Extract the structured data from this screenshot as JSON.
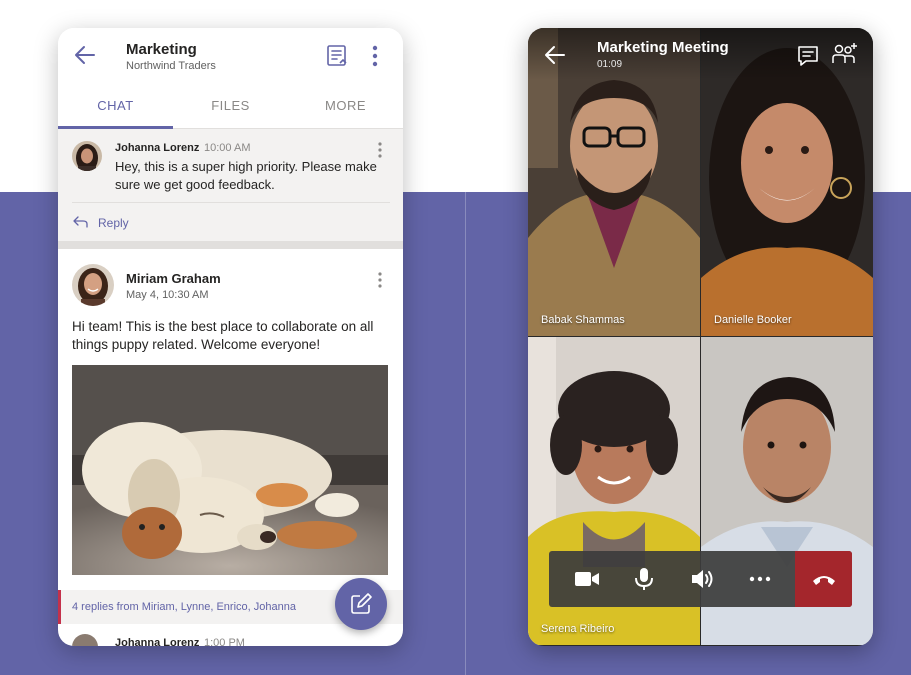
{
  "chat_screen": {
    "header": {
      "title": "Marketing",
      "subtitle": "Northwind Traders"
    },
    "tabs": [
      {
        "label": "CHAT",
        "active": true
      },
      {
        "label": "FILES",
        "active": false
      },
      {
        "label": "MORE",
        "active": false
      }
    ],
    "messages": [
      {
        "author": "Johanna Lorenz",
        "time": "10:00 AM",
        "text": "Hey, this is a super high priority. Please make sure we get good feedback.",
        "reply_label": "Reply"
      },
      {
        "author": "Miriam Graham",
        "time": "May 4, 10:30 AM",
        "text": "Hi team! This is the best place to collaborate on all things puppy related. Welcome everyone!",
        "replies_summary": "4 replies from Miriam, Lynne, Enrico, Johanna"
      },
      {
        "author": "Johanna Lorenz",
        "time": "1:00 PM"
      }
    ],
    "accent_color": "#6264a7"
  },
  "call_screen": {
    "header": {
      "title": "Marketing Meeting",
      "timer": "01:09"
    },
    "participants": [
      {
        "name": "Babak Shammas"
      },
      {
        "name": "Danielle Booker"
      },
      {
        "name": "Serena Ribeiro"
      },
      {
        "name": ""
      }
    ],
    "controls": [
      "video-icon",
      "microphone-icon",
      "speaker-icon",
      "more-icon",
      "hang-up-icon"
    ],
    "hangup_color": "#a4262c"
  }
}
